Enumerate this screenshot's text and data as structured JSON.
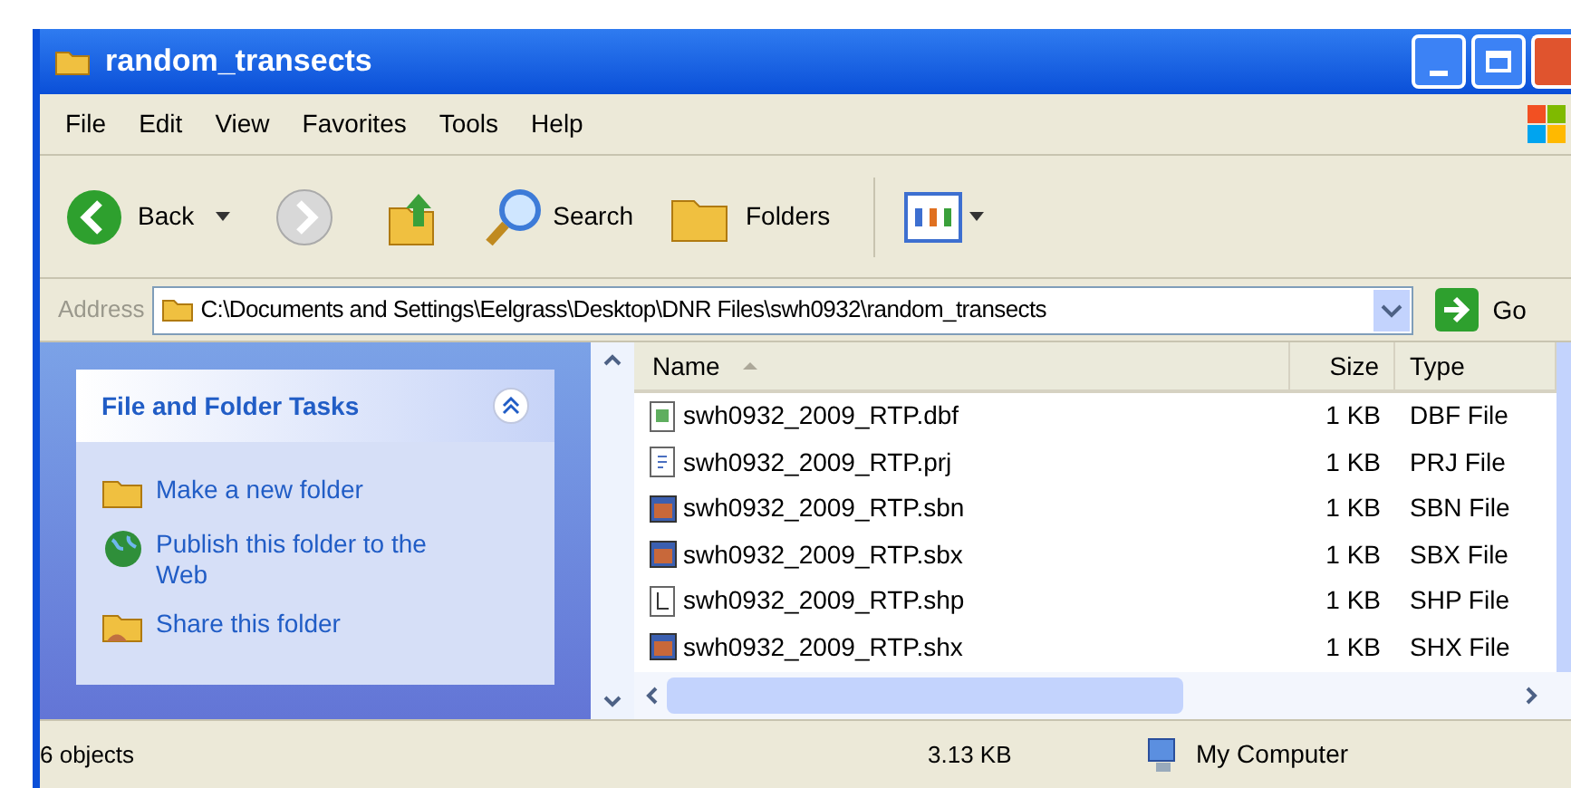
{
  "window": {
    "title": "random_transects"
  },
  "menu": [
    "File",
    "Edit",
    "View",
    "Favorites",
    "Tools",
    "Help"
  ],
  "toolbar": {
    "back": "Back",
    "search": "Search",
    "folders": "Folders"
  },
  "address": {
    "label": "Address",
    "value": "C:\\Documents and Settings\\Eelgrass\\Desktop\\DNR Files\\swh0932\\random_transects",
    "go": "Go"
  },
  "tasks": {
    "title": "File and Folder Tasks",
    "expanded": true,
    "items": [
      {
        "kind": "new-folder",
        "label": "Make a new folder"
      },
      {
        "kind": "publish",
        "label": "Publish this folder to the Web"
      },
      {
        "kind": "share",
        "label": "Share this folder"
      }
    ]
  },
  "table": {
    "columns": [
      {
        "label": "Name",
        "sorted": true
      },
      {
        "label": "Size",
        "sorted": false
      },
      {
        "label": "Type",
        "sorted": false
      }
    ],
    "rows": [
      {
        "kind": "table",
        "name": "swh0932_2009_RTP.dbf",
        "size": "1 KB",
        "type": "DBF File"
      },
      {
        "kind": "text",
        "name": "swh0932_2009_RTP.prj",
        "size": "1 KB",
        "type": "PRJ File"
      },
      {
        "kind": "app",
        "name": "swh0932_2009_RTP.sbn",
        "size": "1 KB",
        "type": "SBN File"
      },
      {
        "kind": "app",
        "name": "swh0932_2009_RTP.sbx",
        "size": "1 KB",
        "type": "SBX File"
      },
      {
        "kind": "shape",
        "name": "swh0932_2009_RTP.shp",
        "size": "1 KB",
        "type": "SHP File"
      },
      {
        "kind": "app",
        "name": "swh0932_2009_RTP.shx",
        "size": "1 KB",
        "type": "SHX File"
      }
    ]
  },
  "status_bar": {
    "objects": "6 objects",
    "size": "3.13 KB",
    "zone": "My Computer"
  }
}
